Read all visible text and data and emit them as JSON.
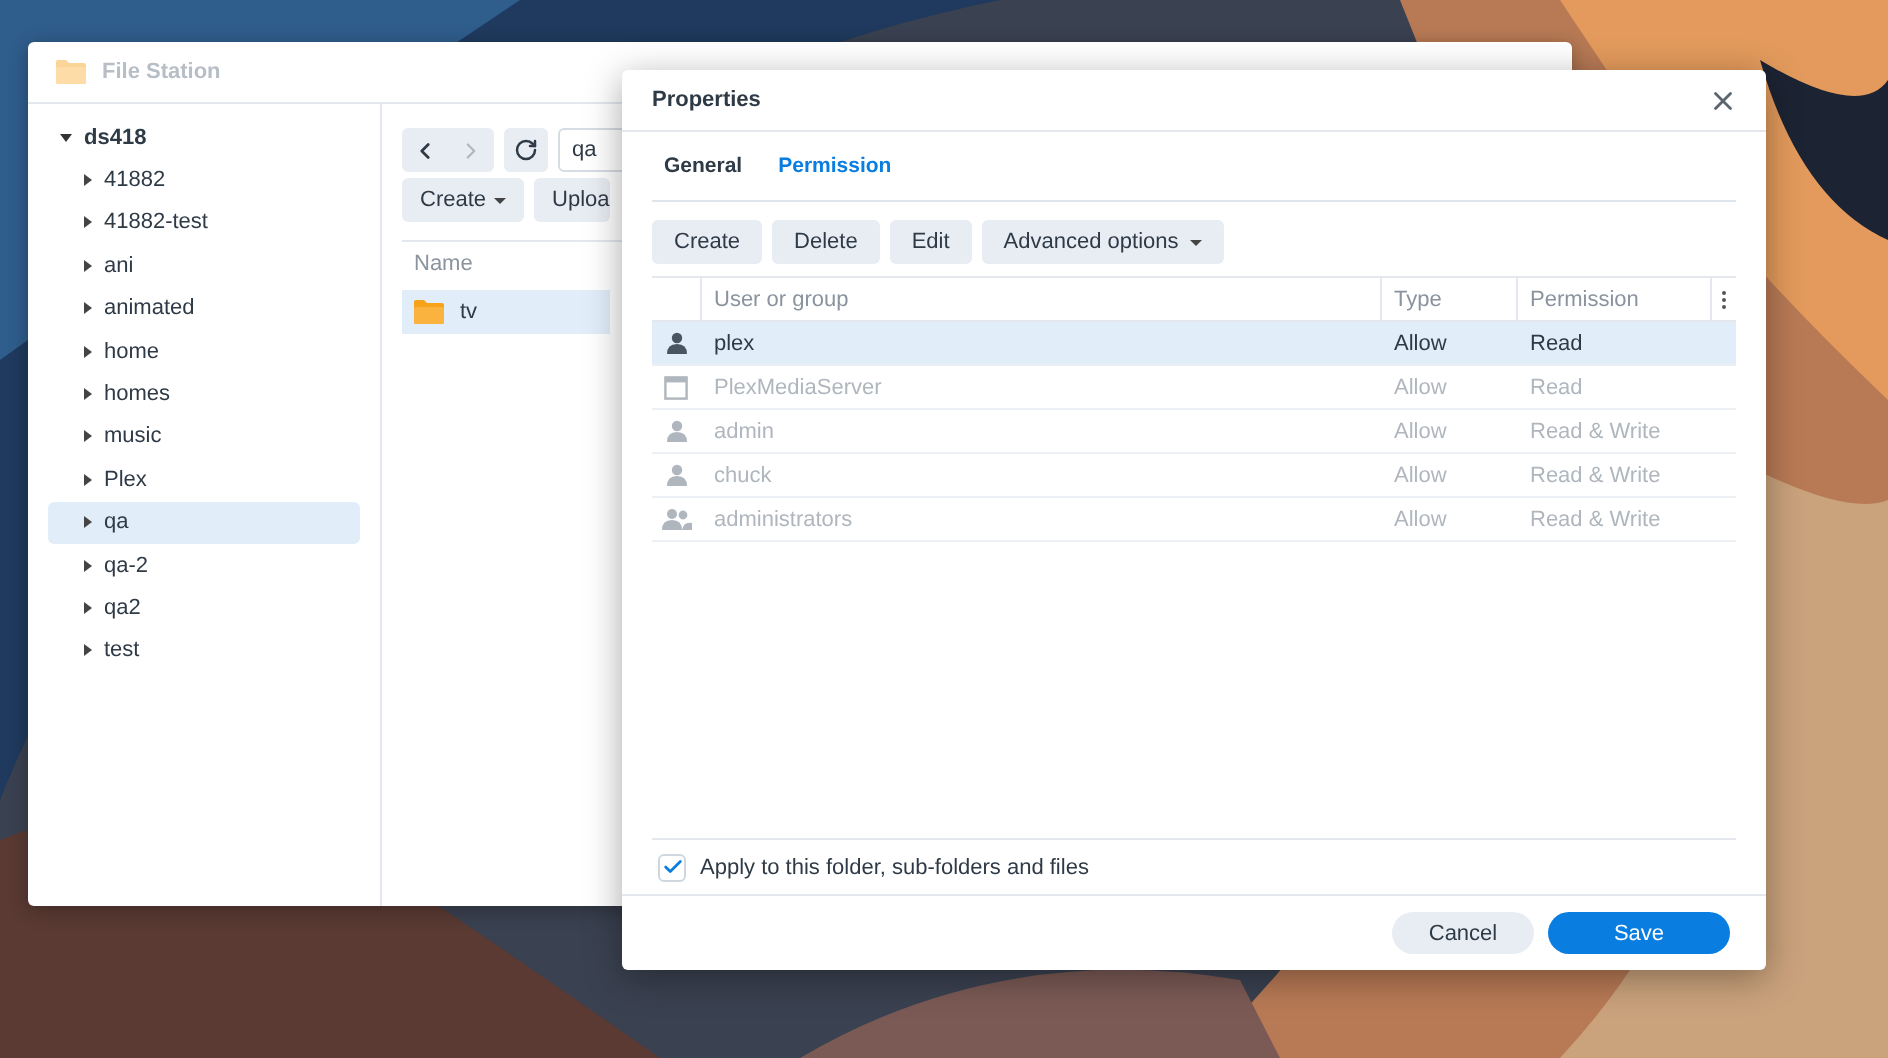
{
  "file_station": {
    "title": "File Station",
    "tree": {
      "label": "ds418",
      "expanded": true,
      "children": [
        {
          "label": "41882",
          "expanded": false,
          "selected": false
        },
        {
          "label": "41882-test",
          "expanded": false,
          "selected": false
        },
        {
          "label": "ani",
          "expanded": false,
          "selected": false
        },
        {
          "label": "animated",
          "expanded": false,
          "selected": false
        },
        {
          "label": "home",
          "expanded": false,
          "selected": false
        },
        {
          "label": "homes",
          "expanded": false,
          "selected": false
        },
        {
          "label": "music",
          "expanded": false,
          "selected": false
        },
        {
          "label": "Plex",
          "expanded": false,
          "selected": false
        },
        {
          "label": "qa",
          "expanded": false,
          "selected": true
        },
        {
          "label": "qa-2",
          "expanded": false,
          "selected": false
        },
        {
          "label": "qa2",
          "expanded": false,
          "selected": false
        },
        {
          "label": "test",
          "expanded": false,
          "selected": false
        }
      ]
    },
    "path": "qa",
    "buttons": [
      {
        "label": "Create",
        "kind": "dropdown"
      },
      {
        "label": "Uploa",
        "kind": "plain"
      }
    ],
    "file_list": {
      "columns": [
        "Name"
      ],
      "rows": [
        {
          "name": "tv",
          "selected": true
        }
      ]
    }
  },
  "dialog": {
    "title": "Properties",
    "tabs": [
      {
        "label": "General",
        "selected": false
      },
      {
        "label": "Permission",
        "selected": true
      }
    ],
    "buttons": [
      {
        "label": "Create",
        "kind": "plain"
      },
      {
        "label": "Delete",
        "kind": "plain"
      },
      {
        "label": "Edit",
        "kind": "plain"
      },
      {
        "label": "Advanced options",
        "kind": "dropdown"
      }
    ],
    "table": {
      "columns": [
        "User or group",
        "Type",
        "Permission"
      ],
      "rows": [
        {
          "kind": "user",
          "name": "plex",
          "type": "Allow",
          "permission": "Read",
          "selected": true,
          "disabled": false
        },
        {
          "kind": "app",
          "name": "PlexMediaServer",
          "type": "Allow",
          "permission": "Read",
          "selected": false,
          "disabled": true
        },
        {
          "kind": "user",
          "name": "admin",
          "type": "Allow",
          "permission": "Read & Write",
          "selected": false,
          "disabled": true
        },
        {
          "kind": "user",
          "name": "chuck",
          "type": "Allow",
          "permission": "Read & Write",
          "selected": false,
          "disabled": true
        },
        {
          "kind": "group",
          "name": "administrators",
          "type": "Allow",
          "permission": "Read & Write",
          "selected": false,
          "disabled": true
        }
      ]
    },
    "apply": {
      "label": "Apply to this folder, sub-folders and files",
      "checked": true
    },
    "footer": [
      {
        "label": "Cancel",
        "kind": "secondary"
      },
      {
        "label": "Save",
        "kind": "primary"
      }
    ]
  }
}
